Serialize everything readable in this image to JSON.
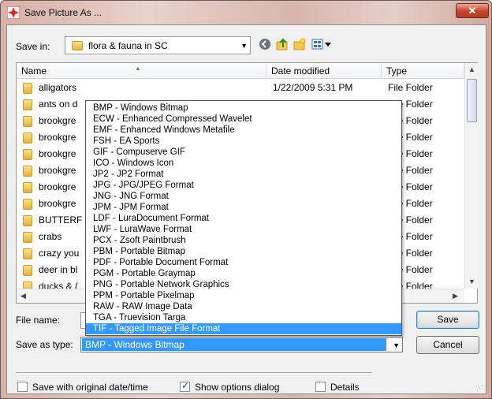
{
  "window": {
    "title": "Save Picture As ...",
    "close_glyph": "✕"
  },
  "toolbar": {
    "save_in_label": "Save in:",
    "save_in_value": "flora & fauna in SC",
    "icons": [
      "back-icon",
      "up-folder-icon",
      "new-folder-icon",
      "views-menu-icon"
    ]
  },
  "columns": [
    "Name",
    "Date modified",
    "Type"
  ],
  "rows": [
    {
      "name": "alligators",
      "date": "1/22/2009 5:31 PM",
      "type": "File Folder"
    },
    {
      "name": "ants on d",
      "date": "",
      "type": "File Folder"
    },
    {
      "name": "brookgre",
      "date": "",
      "type": "File Folder"
    },
    {
      "name": "brookgre",
      "date": "",
      "type": "File Folder"
    },
    {
      "name": "brookgre",
      "date": "",
      "type": "File Folder"
    },
    {
      "name": "brookgre",
      "date": "",
      "type": "File Folder"
    },
    {
      "name": "brookgre",
      "date": "",
      "type": "File Folder"
    },
    {
      "name": "brookgre",
      "date": "",
      "type": "File Folder"
    },
    {
      "name": "BUTTERF",
      "date": "",
      "type": "File Folder"
    },
    {
      "name": "crabs",
      "date": "",
      "type": "File Folder"
    },
    {
      "name": "crazy you",
      "date": "",
      "type": "File Folder"
    },
    {
      "name": "deer in bl",
      "date": "",
      "type": "File Folder"
    },
    {
      "name": "ducks & (",
      "date": "",
      "type": "File Folder"
    }
  ],
  "filetype_options": [
    "BMP - Windows Bitmap",
    "ECW - Enhanced Compressed Wavelet",
    "EMF - Enhanced Windows Metafile",
    "FSH - EA Sports",
    "GIF - Compuserve GIF",
    "ICO - Windows Icon",
    "JP2 - JP2 Format",
    "JPG - JPG/JPEG Format",
    "JNG - JNG Format",
    "JPM - JPM Format",
    "LDF - LuraDocument Format",
    "LWF - LuraWave Format",
    "PCX - Zsoft Paintbrush",
    "PBM - Portable Bitmap",
    "PDF - Portable Document Format",
    "PGM - Portable Graymap",
    "PNG - Portable Network Graphics",
    "PPM - Portable Pixelmap",
    "RAW - RAW Image Data",
    "TGA - Truevision Targa",
    "TIF - Tagged Image File Format"
  ],
  "highlighted_option": "TIF - Tagged Image File Format",
  "form": {
    "file_name_label": "File name:",
    "file_name_value": "",
    "save_as_type_label": "Save as type:",
    "save_as_type_value": "BMP - Windows Bitmap"
  },
  "buttons": {
    "save": "Save",
    "cancel": "Cancel"
  },
  "options": {
    "save_original_date": {
      "label": "Save with original date/time",
      "checked": false
    },
    "show_options_dialog": {
      "label": "Show options dialog",
      "checked": true
    },
    "details": {
      "label": "Details",
      "checked": false
    }
  },
  "colors": {
    "selection": "#3399ff",
    "close_button": "#c4422e"
  }
}
